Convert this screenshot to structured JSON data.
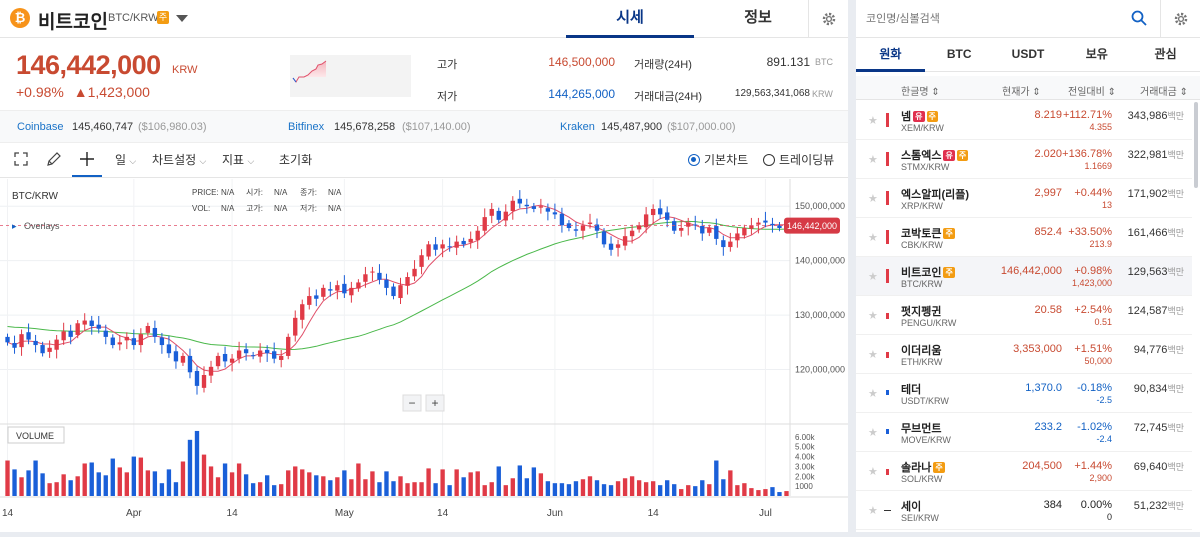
{
  "header": {
    "coin_symbol_glyph": "₿",
    "coin_name": "비트코인",
    "pair": "BTC/KRW",
    "warn_badge": "주",
    "tabs": [
      {
        "label": "시세",
        "active": true
      },
      {
        "label": "정보",
        "active": false
      }
    ]
  },
  "price": {
    "current": "146,442,000",
    "unit": "KRW",
    "change_pct": "+0.98%",
    "change_abs": "▲1,423,000",
    "high_label": "고가",
    "high": "146,500,000",
    "low_label": "저가",
    "low": "144,265,000",
    "volume_label": "거래량(24H)",
    "volume": "891.131",
    "volume_unit": "BTC",
    "amount_label": "거래대금(24H)",
    "amount": "129,563,341,068",
    "amount_unit": "KRW"
  },
  "exchanges": [
    {
      "name": "Coinbase",
      "value": "145,460,747",
      "usd": "($106,980.03)"
    },
    {
      "name": "Bitfinex",
      "value": "145,678,258",
      "usd": "($107,140.00)"
    },
    {
      "name": "Kraken",
      "value": "145,487,900",
      "usd": "($107,000.00)"
    }
  ],
  "toolbar": {
    "interval": "일",
    "chart_settings": "차트설정",
    "indicators": "지표",
    "reset": "초기화",
    "basic_chart": "기본차트",
    "tradingview": "트레이딩뷰"
  },
  "chart_data": {
    "type": "candlestick",
    "title": "BTC/KRW",
    "overlays_label": "Overlays",
    "volume_label": "VOLUME",
    "legend": {
      "price_label": "PRICE:",
      "price": "N/A",
      "open_label": "시가:",
      "open": "N/A",
      "close_label": "종가:",
      "close": "N/A",
      "vol_label": "VOL:",
      "vol": "N/A",
      "high_label": "고가:",
      "high": "N/A",
      "low_label": "저가:",
      "low": "N/A"
    },
    "last_price_tag": "146,442,000",
    "ylim": [
      110000000,
      155000000
    ],
    "y_ticks": [
      "150,000,000",
      "140,000,000",
      "130,000,000",
      "120,000,000"
    ],
    "y_tick_values": [
      150000000,
      140000000,
      130000000,
      120000000
    ],
    "vol_ticks": [
      "6.00k",
      "5.00k",
      "4.00k",
      "3.00k",
      "2.00k",
      "1000"
    ],
    "vol_tick_values": [
      6000,
      5000,
      4000,
      3000,
      2000,
      1000
    ],
    "vol_max": 7000,
    "x_ticks": [
      "14",
      "Apr",
      "14",
      "May",
      "14",
      "Jun",
      "14",
      "Jul"
    ],
    "x_tick_index": [
      0,
      18,
      32,
      48,
      62,
      78,
      92,
      108
    ],
    "closes_m": [
      125.0,
      124.0,
      126.5,
      125.5,
      124.5,
      123.0,
      124.0,
      125.5,
      127.0,
      126.0,
      128.5,
      129.0,
      128.0,
      127.5,
      126.0,
      124.5,
      125.0,
      126.0,
      124.5,
      126.5,
      128.0,
      126.0,
      124.5,
      123.0,
      121.5,
      122.5,
      119.5,
      117.0,
      119.0,
      120.5,
      122.5,
      121.5,
      122.0,
      123.5,
      123.0,
      122.5,
      123.5,
      123.0,
      122.0,
      122.5,
      126.0,
      129.5,
      132.0,
      133.5,
      133.0,
      135.0,
      134.5,
      135.5,
      134.0,
      135.0,
      136.0,
      137.5,
      138.0,
      136.5,
      135.0,
      133.5,
      135.5,
      137.0,
      138.5,
      141.0,
      143.0,
      142.0,
      143.0,
      142.5,
      143.5,
      143.0,
      144.0,
      145.5,
      148.0,
      149.5,
      147.5,
      149.0,
      151.0,
      150.5,
      150.0,
      149.5,
      150.0,
      149.0,
      148.5,
      146.5,
      146.0,
      145.5,
      146.5,
      147.0,
      145.5,
      143.0,
      142.0,
      143.0,
      144.5,
      145.5,
      146.5,
      148.5,
      149.5,
      148.5,
      147.5,
      145.5,
      146.0,
      147.0,
      146.5,
      145.0,
      146.0,
      144.0,
      142.5,
      143.5,
      145.0,
      146.0,
      146.5,
      147.0,
      147.0,
      146.5,
      146.0,
      146.442
    ],
    "volumes_k": [
      3.6,
      2.7,
      1.9,
      2.6,
      3.6,
      2.3,
      1.3,
      1.4,
      2.2,
      1.6,
      2.0,
      3.3,
      3.4,
      2.4,
      2.1,
      3.8,
      2.9,
      2.4,
      4.0,
      3.9,
      2.6,
      2.5,
      1.3,
      2.7,
      1.4,
      3.5,
      5.7,
      6.6,
      4.2,
      3.0,
      1.9,
      3.3,
      2.4,
      3.3,
      2.2,
      1.3,
      1.4,
      2.1,
      1.1,
      1.2,
      2.6,
      3.0,
      2.7,
      2.4,
      2.1,
      2.0,
      1.6,
      1.9,
      2.6,
      1.7,
      3.3,
      1.7,
      2.5,
      1.4,
      2.5,
      1.5,
      2.0,
      1.3,
      1.4,
      1.4,
      2.8,
      1.3,
      2.7,
      1.1,
      2.7,
      1.9,
      2.4,
      2.5,
      1.1,
      1.4,
      3.0,
      1.1,
      1.8,
      3.1,
      1.8,
      2.9,
      2.3,
      1.5,
      1.3,
      1.3,
      1.2,
      1.5,
      1.7,
      2.0,
      1.6,
      1.2,
      1.1,
      1.5,
      1.8,
      2.0,
      1.6,
      1.4,
      1.5,
      1.1,
      1.6,
      1.2,
      0.7,
      1.1,
      1.0,
      1.6,
      1.2,
      3.6,
      1.7,
      2.6,
      1.1,
      1.3,
      0.8,
      0.6,
      0.7,
      0.9,
      0.4,
      0.5
    ],
    "ma_short_color": "#e0506a",
    "ma_long_color": "#4ab84a",
    "up_color": "#e03a46",
    "down_color": "#1a5fd8"
  },
  "sidebar": {
    "search_placeholder": "코인명/심볼검색",
    "tabs": [
      {
        "label": "원화",
        "active": true
      },
      {
        "label": "BTC"
      },
      {
        "label": "USDT"
      },
      {
        "label": "보유"
      },
      {
        "label": "관심"
      }
    ],
    "columns": {
      "name": "한글명 ⇕",
      "price": "현재가 ⇕",
      "change": "전일대비 ⇕",
      "volume": "거래대금 ⇕"
    },
    "rows": [
      {
        "name": "넴",
        "badges": [
          "유",
          "주"
        ],
        "symbol": "XEM/KRW",
        "price": "8.219",
        "pct": "+112.71%",
        "abs": "4.355",
        "vol": "343,986",
        "unit": "백만",
        "dir": "up",
        "sel": false
      },
      {
        "name": "스톰엑스",
        "badges": [
          "유",
          "주"
        ],
        "symbol": "STMX/KRW",
        "price": "2.020",
        "pct": "+136.78%",
        "abs": "1.1669",
        "vol": "322,981",
        "unit": "백만",
        "dir": "up",
        "sel": false
      },
      {
        "name": "엑스알피(리플)",
        "badges": [],
        "symbol": "XRP/KRW",
        "price": "2,997",
        "pct": "+0.44%",
        "abs": "13",
        "vol": "171,902",
        "unit": "백만",
        "dir": "up",
        "sel": false
      },
      {
        "name": "코박토큰",
        "badges": [
          "주"
        ],
        "symbol": "CBK/KRW",
        "price": "852.4",
        "pct": "+33.50%",
        "abs": "213.9",
        "vol": "161,466",
        "unit": "백만",
        "dir": "up",
        "sel": false
      },
      {
        "name": "비트코인",
        "badges": [
          "주"
        ],
        "symbol": "BTC/KRW",
        "price": "146,442,000",
        "pct": "+0.98%",
        "abs": "1,423,000",
        "vol": "129,563",
        "unit": "백만",
        "dir": "up",
        "sel": true
      },
      {
        "name": "펏지펭귄",
        "badges": [],
        "symbol": "PENGU/KRW",
        "price": "20.58",
        "pct": "+2.54%",
        "abs": "0.51",
        "vol": "124,587",
        "unit": "백만",
        "dir": "up",
        "sel": false
      },
      {
        "name": "이더리움",
        "badges": [],
        "symbol": "ETH/KRW",
        "price": "3,353,000",
        "pct": "+1.51%",
        "abs": "50,000",
        "vol": "94,776",
        "unit": "백만",
        "dir": "up",
        "sel": false
      },
      {
        "name": "테더",
        "badges": [],
        "symbol": "USDT/KRW",
        "price": "1,370.0",
        "pct": "-0.18%",
        "abs": "-2.5",
        "vol": "90,834",
        "unit": "백만",
        "dir": "down",
        "sel": false
      },
      {
        "name": "무브먼트",
        "badges": [],
        "symbol": "MOVE/KRW",
        "price": "233.2",
        "pct": "-1.02%",
        "abs": "-2.4",
        "vol": "72,745",
        "unit": "백만",
        "dir": "down",
        "sel": false
      },
      {
        "name": "솔라나",
        "badges": [
          "주"
        ],
        "symbol": "SOL/KRW",
        "price": "204,500",
        "pct": "+1.44%",
        "abs": "2,900",
        "vol": "69,640",
        "unit": "백만",
        "dir": "up",
        "sel": false
      },
      {
        "name": "세이",
        "badges": [],
        "symbol": "SEI/KRW",
        "price": "384",
        "pct": "0.00%",
        "abs": "0",
        "vol": "51,232",
        "unit": "백만",
        "dir": "flat",
        "sel": false
      }
    ]
  }
}
